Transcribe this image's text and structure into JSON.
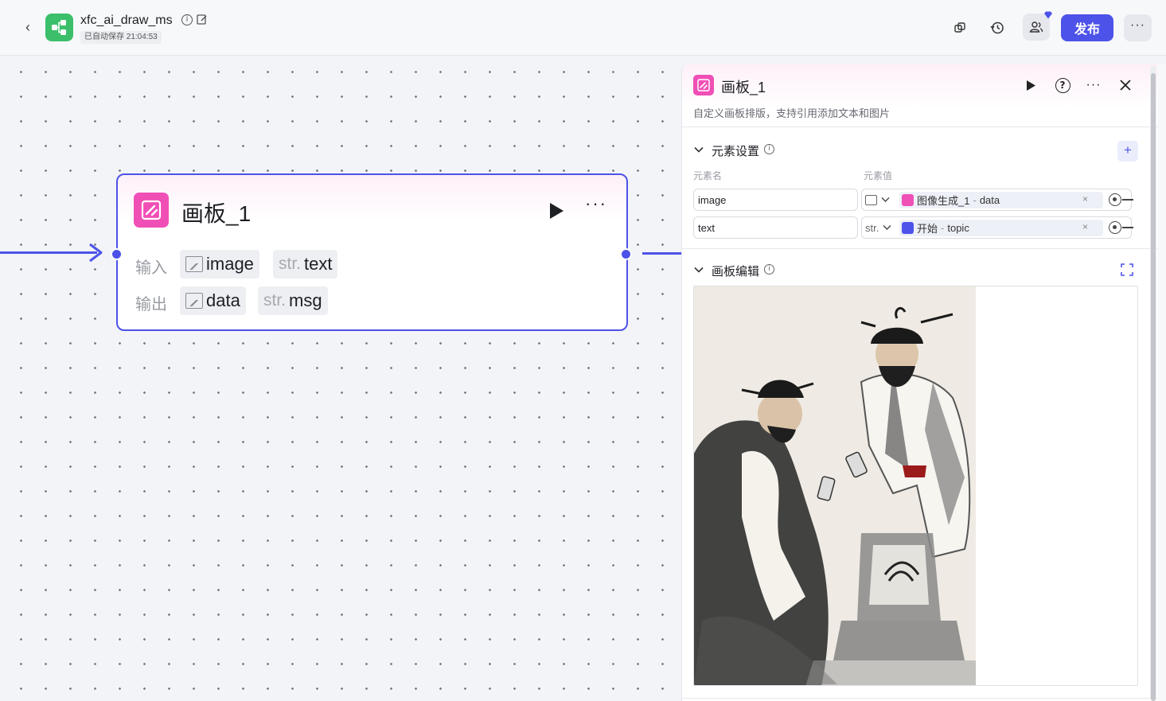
{
  "header": {
    "back_icon": "chevron-left-icon",
    "app_title": "xfc_ai_draw_ms",
    "autosave": "已自动保存 21:04:53",
    "publish_label": "发布",
    "more_label": "···",
    "accent_color": "#4d53e8",
    "logo_color": "#3bbf6a",
    "icons": [
      "copy-icon",
      "history-icon",
      "collaborator-icon",
      "more-icon"
    ]
  },
  "node": {
    "title": "画板_1",
    "icon": "canvas-board-icon",
    "icon_color": "#f04fb6",
    "input_label": "输入",
    "output_label": "输出",
    "inputs": [
      {
        "type": "image",
        "type_label": "",
        "name": "image"
      },
      {
        "type": "str",
        "type_label": "str.",
        "name": "text"
      }
    ],
    "outputs": [
      {
        "type": "image",
        "type_label": "",
        "name": "data"
      },
      {
        "type": "str",
        "type_label": "str.",
        "name": "msg"
      }
    ]
  },
  "panel": {
    "title": "画板_1",
    "subtitle": "自定义画板排版，支持引用添加文本和图片",
    "element_section": {
      "title": "元素设置",
      "add_label": "+",
      "col_name": "元素名",
      "col_value": "元素值",
      "rows": [
        {
          "name": "image",
          "type": "image",
          "type_label": "",
          "ref_source": "图像生成_1",
          "ref_sep": " - ",
          "ref_field": "data",
          "ref_icon_color": "#f04fb6",
          "remove_label": "×"
        },
        {
          "name": "text",
          "type": "str",
          "type_label": "str.",
          "ref_source": "开始",
          "ref_sep": " - ",
          "ref_field": "topic",
          "ref_icon_color": "#4d53e8",
          "remove_label": "×"
        }
      ]
    },
    "board_section": {
      "title": "画板编辑"
    }
  }
}
